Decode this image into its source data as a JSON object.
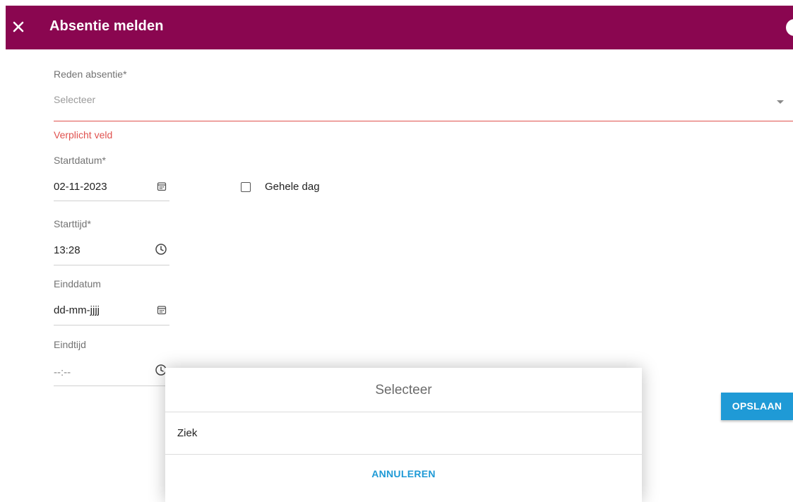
{
  "header": {
    "title": "Absentie melden"
  },
  "form": {
    "reason": {
      "label": "Reden absentie*",
      "placeholder": "Selecteer",
      "error": "Verplicht veld"
    },
    "start_date": {
      "label": "Startdatum*",
      "value": "02-11-2023"
    },
    "whole_day": {
      "label": "Gehele dag",
      "checked": false
    },
    "start_time": {
      "label": "Starttijd*",
      "value": "13:28"
    },
    "end_date": {
      "label": "Einddatum",
      "value": "dd-mm-jjjj"
    },
    "end_time": {
      "label": "Eindtijd",
      "value": "--:--"
    }
  },
  "actions": {
    "save_label": "OPSLAAN"
  },
  "dialog": {
    "title": "Selecteer",
    "options": [
      {
        "label": "Ziek"
      }
    ],
    "cancel_label": "ANNULEREN"
  },
  "colors": {
    "header_bg": "#8a0650",
    "primary": "#1f9ad6",
    "error": "#e0524f"
  }
}
